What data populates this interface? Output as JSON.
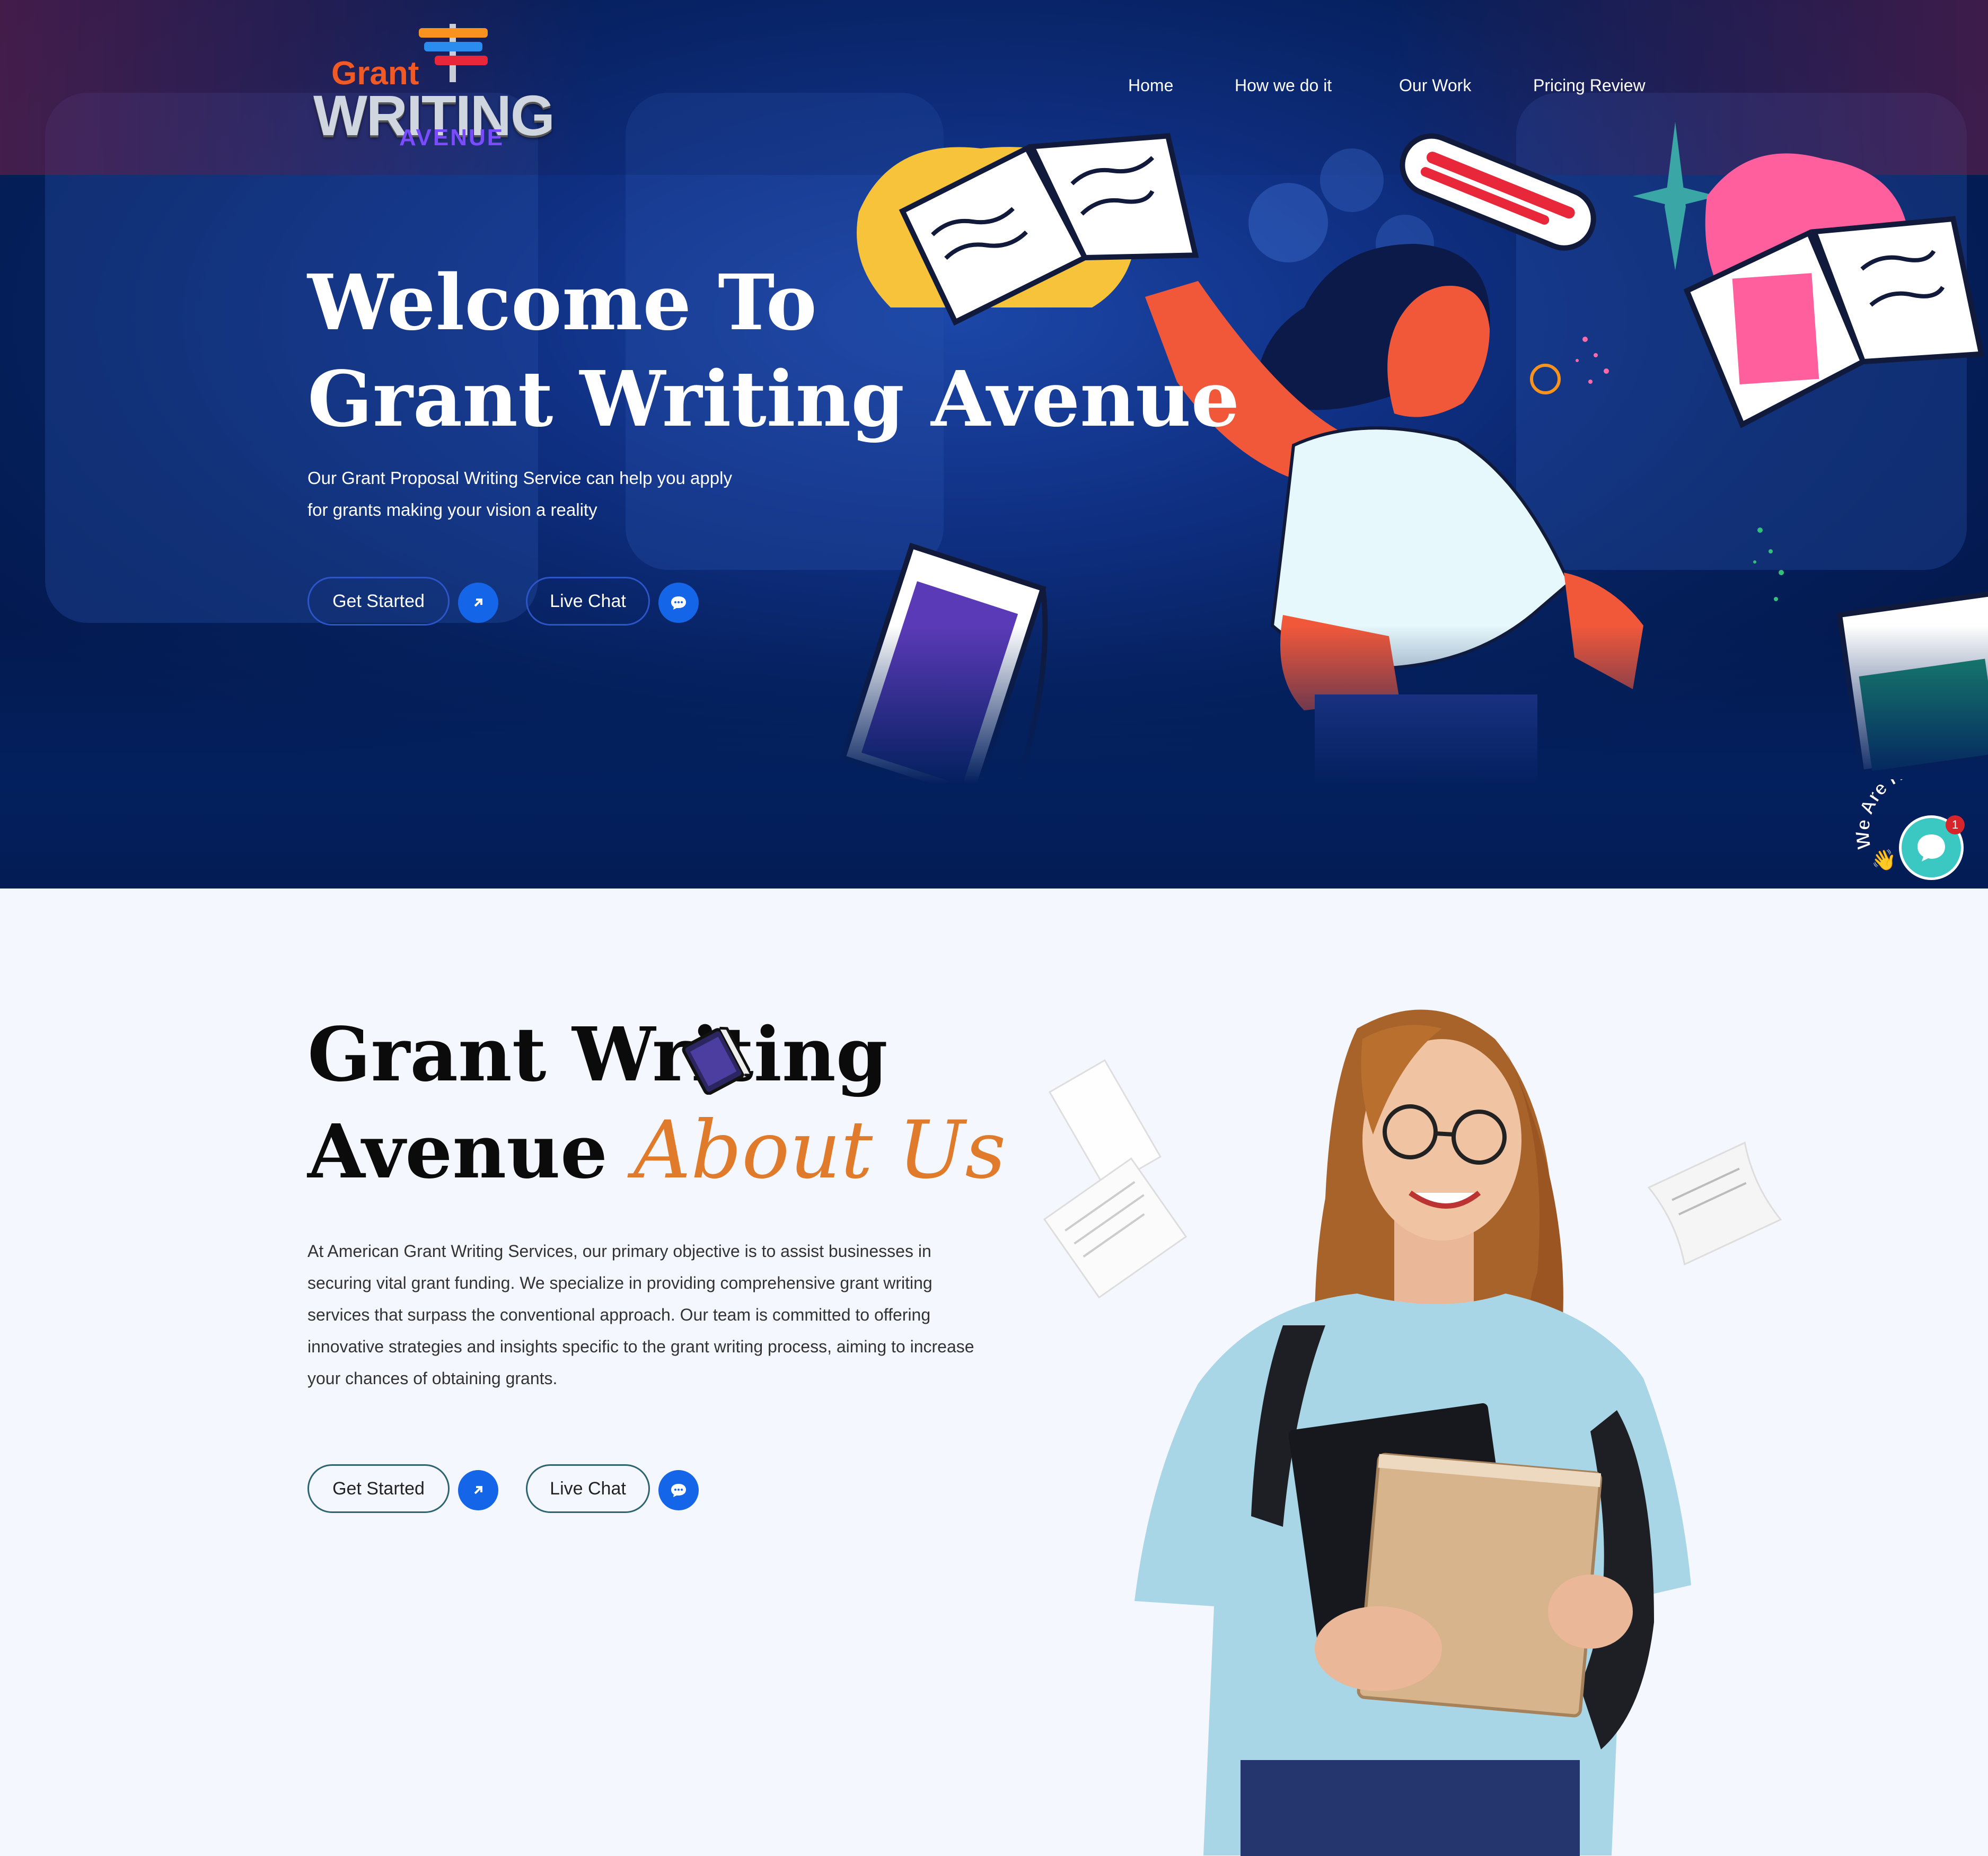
{
  "brand": {
    "logo_top": "Grant",
    "logo_main": "WRITING",
    "logo_bottom": "AVENUE"
  },
  "nav": {
    "items": [
      "Home",
      "How we do it",
      "Our Work",
      "Pricing Review"
    ]
  },
  "hero": {
    "title_line1": "Welcome To",
    "title_line2": "Grant Writing Avenue",
    "subtitle_line1": "Our Grant Proposal Writing Service can help you apply",
    "subtitle_line2": "for grants making your vision a reality",
    "get_started_label": "Get Started",
    "live_chat_label": "Live Chat"
  },
  "chat_widget": {
    "badge_text": "We Are Here!",
    "notification_count": "1"
  },
  "about": {
    "title_line1": "Grant Writing",
    "title_line2_a": "Avenue",
    "title_line2_b": "About Us",
    "body": "At American Grant Writing Services, our primary objective is to assist businesses in securing vital grant funding. We specialize in providing comprehensive grant writing services that surpass the conventional approach. Our team is committed to offering innovative strategies and insights specific to the grant writing process, aiming to increase your chances of obtaining grants.",
    "get_started_label": "Get Started",
    "live_chat_label": "Live Chat"
  },
  "colors": {
    "hero_bg": "#031c55",
    "accent_blue": "#1565e8",
    "script_orange": "#e07b2c",
    "page_bg": "#f4f7fd"
  },
  "icons": {
    "button_arrow": "arrow-up-right-icon",
    "chat_bubble": "chat-bubble-icon"
  }
}
